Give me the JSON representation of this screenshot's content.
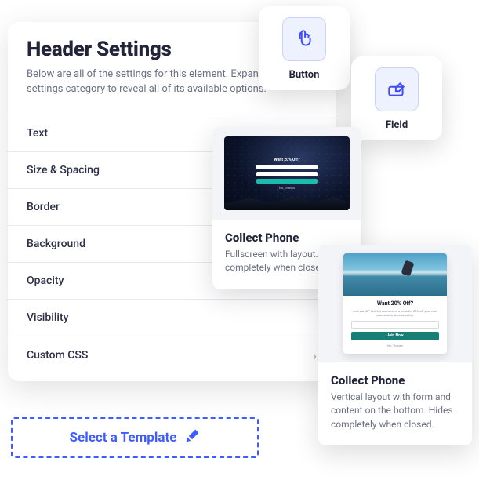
{
  "settings": {
    "title": "Header Settings",
    "description": "Below are all of the settings for this element. Expand each settings category to reveal all of its available options.",
    "categories": [
      {
        "label": "Text",
        "has_chevron": false
      },
      {
        "label": "Size & Spacing",
        "has_chevron": false
      },
      {
        "label": "Border",
        "has_chevron": false
      },
      {
        "label": "Background",
        "has_chevron": false
      },
      {
        "label": "Opacity",
        "has_chevron": false
      },
      {
        "label": "Visibility",
        "has_chevron": false
      },
      {
        "label": "Custom CSS",
        "has_chevron": true
      }
    ]
  },
  "elements": {
    "button_label": "Button",
    "field_label": "Field"
  },
  "templates": {
    "card1": {
      "thumb_headline": "Want 20% Off?",
      "thumb_cta_link": "No, Thanks",
      "title": "Collect Phone",
      "description": "Fullscreen with layout. Hides completely when closed."
    },
    "card2": {
      "thumb_headline": "Want 20% Off?",
      "thumb_sub": "Join our VIP text list and receive a code for 20% off your next purchase in store or online",
      "thumb_btn": "Join Now",
      "thumb_link": "No, Thanks",
      "title": "Collect Phone",
      "description": "Vertical layout with form and content on the bottom. Hides completely when closed."
    }
  },
  "actions": {
    "select_template": "Select a Template"
  }
}
